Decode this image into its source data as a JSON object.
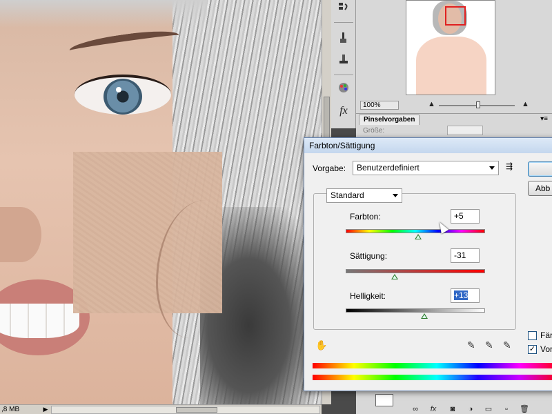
{
  "status": {
    "doc_size": ",8 MB",
    "arrow": "▶"
  },
  "toolstrip": {
    "icons": [
      "history-icon",
      "brush-preset-icon",
      "clone-source-icon",
      "styles-icon",
      "fx-icon"
    ],
    "fx_label": "fx"
  },
  "navigator": {
    "zoom": "100%"
  },
  "brush_panel": {
    "tab": "Pinselvorgaben",
    "size_label": "Größe:",
    "menu": "▾≡"
  },
  "dialog": {
    "title": "Farbton/Sättigung",
    "preset_label": "Vorgabe:",
    "preset_value": "Benutzerdefiniert",
    "preset_menu": "⇶",
    "channel_value": "Standard",
    "hue": {
      "label": "Farbton:",
      "value": "+5",
      "level": 0.52
    },
    "saturation": {
      "label": "Sättigung:",
      "value": "-31",
      "level": 0.35
    },
    "lightness": {
      "label": "Helligkeit:",
      "value": "+13",
      "level": 0.565
    },
    "buttons": {
      "ok": "",
      "cancel": "Abb"
    },
    "checkboxes": {
      "colorize": "Färb",
      "preview": "Vors",
      "preview_mark": "✓"
    },
    "hand_glyph": "✋",
    "eyedroppers": [
      "✎",
      "✎",
      "✎"
    ]
  },
  "layers": {
    "buttons": [
      "∞",
      "fx",
      "◙",
      "◑",
      "▭",
      "▫",
      "🗑"
    ]
  }
}
